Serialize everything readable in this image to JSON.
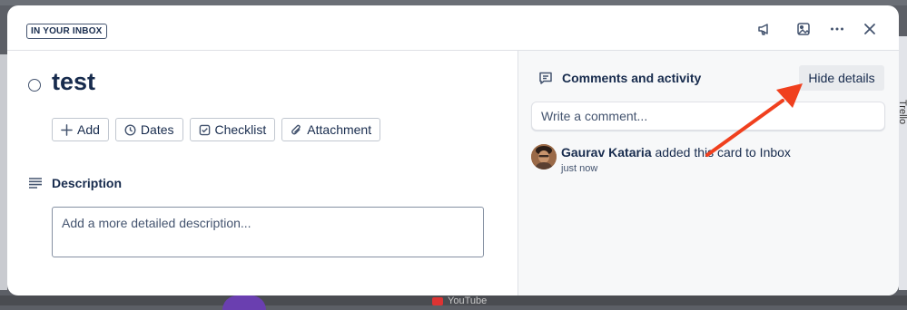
{
  "header": {
    "badge": "IN YOUR INBOX",
    "icons": [
      "megaphone-icon",
      "image-icon",
      "more-icon",
      "close-icon"
    ]
  },
  "card": {
    "title": "test",
    "actions": [
      {
        "label": "Add",
        "icon": "plus-icon"
      },
      {
        "label": "Dates",
        "icon": "clock-icon"
      },
      {
        "label": "Checklist",
        "icon": "checkbox-icon"
      },
      {
        "label": "Attachment",
        "icon": "paperclip-icon"
      }
    ]
  },
  "description": {
    "title": "Description",
    "placeholder": "Add a more detailed description..."
  },
  "activity": {
    "title": "Comments and activity",
    "hide_label": "Hide details",
    "comment_placeholder": "Write a comment...",
    "entries": [
      {
        "user": "Gaurav Kataria",
        "action": " added this card to Inbox",
        "time": "just now"
      }
    ]
  },
  "background": {
    "youtube": "YouTube",
    "side_label": "Trello"
  },
  "colors": {
    "annotation_arrow": "#f0401e",
    "panel_bg": "#f7f8f9",
    "text": "#172b4d"
  }
}
